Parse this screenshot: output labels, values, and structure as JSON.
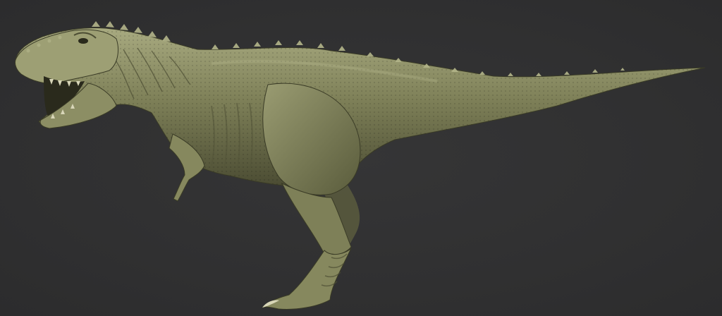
{
  "scene": {
    "subject_icon": "tyrannosaurus-icon",
    "colors": {
      "background": "#303031",
      "skin_light": "#a8aa80",
      "skin_mid": "#7e8058",
      "skin_dark": "#4a4b32",
      "shadow": "#262619"
    }
  }
}
